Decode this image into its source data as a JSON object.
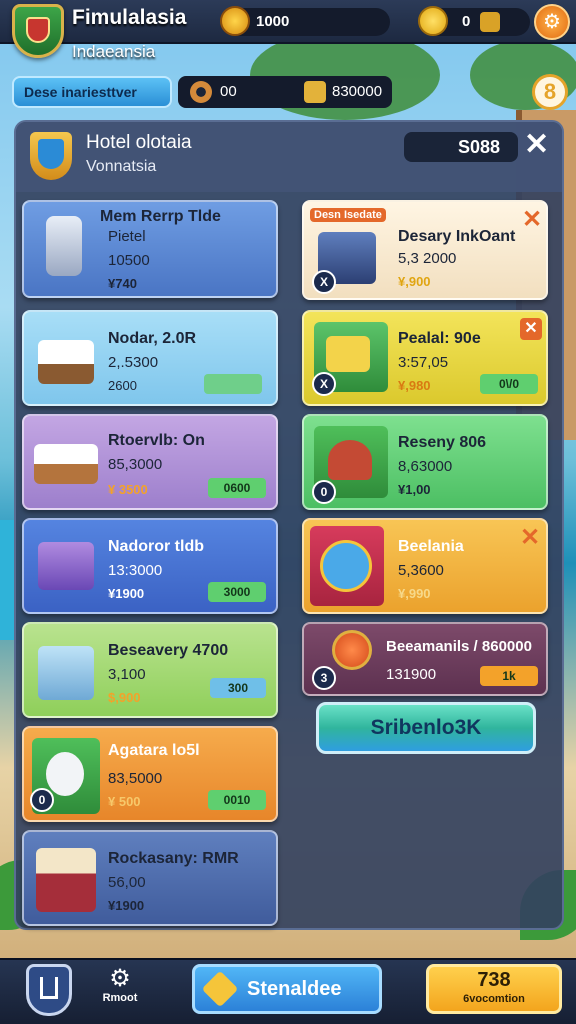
{
  "topbar": {
    "title": "Fimulalasia",
    "subtitle": "Indaeansia",
    "coins": "1000",
    "gems": "0"
  },
  "subbar": {
    "button_label": "Dese inariesttver",
    "val1": "00",
    "val2": "830000"
  },
  "panel": {
    "title": "Hotel olotaia",
    "subtitle": "Vonnatsia",
    "value": "S088"
  },
  "left_cards": [
    {
      "title": "Mem Rerrp Tlde",
      "line2": "Pietel",
      "value": "10500",
      "price": "¥740",
      "action": ""
    },
    {
      "title": "Nodar, 2.0R",
      "line2": "",
      "value": "2,.5300",
      "price": "2600",
      "action": ""
    },
    {
      "title": "Rtoervlb: On",
      "line2": "",
      "value": "85,3000",
      "price": "¥ 3500",
      "action": "0600"
    },
    {
      "title": "Nadoror tldb",
      "line2": "",
      "value": "13:3000",
      "price": "¥1900",
      "action": "3000"
    },
    {
      "title": "Beseavery 4700",
      "line2": "",
      "value": "3,100",
      "price": "$,900",
      "action": "300"
    },
    {
      "title": "Agatara lo5l",
      "line2": "",
      "value": "83,5000",
      "price": "¥ 500",
      "action": "0010",
      "badge": "0"
    },
    {
      "title": "Rockasany: RMR",
      "line2": "",
      "value": "56,00",
      "price": "¥1900",
      "action": ""
    }
  ],
  "right_cards": [
    {
      "tag": "Desn Isedate",
      "title": "Desary InkOant",
      "value": "5,3 2000",
      "price": "¥,900",
      "action": "",
      "badge": "X",
      "x": true
    },
    {
      "title": "Pealal: 90e",
      "value": "3:57,05",
      "price": "¥,980",
      "action": "0\\/0",
      "badge": "X",
      "x": true
    },
    {
      "title": "Reseny 806",
      "value": "8,63000",
      "price": "¥1,00",
      "action": "",
      "badge": "0"
    },
    {
      "title": "Beelania",
      "value": "5,3600",
      "price": "¥,990",
      "action": "",
      "x": true
    },
    {
      "title": "Beeamanils / 860000",
      "value": "131900",
      "price": "",
      "action": "1k",
      "badge": "3"
    }
  ],
  "cta_label": "Sribenlo3K",
  "bottom": {
    "settings_label": "Rmoot",
    "main_label": "Stenaldee",
    "right_number": "738",
    "right_label": "6vocomtion"
  },
  "colors": {
    "panel": "#34425f",
    "topbar": "#1d2941",
    "accent_orange": "#e16a10",
    "cta": "#30b59d"
  }
}
